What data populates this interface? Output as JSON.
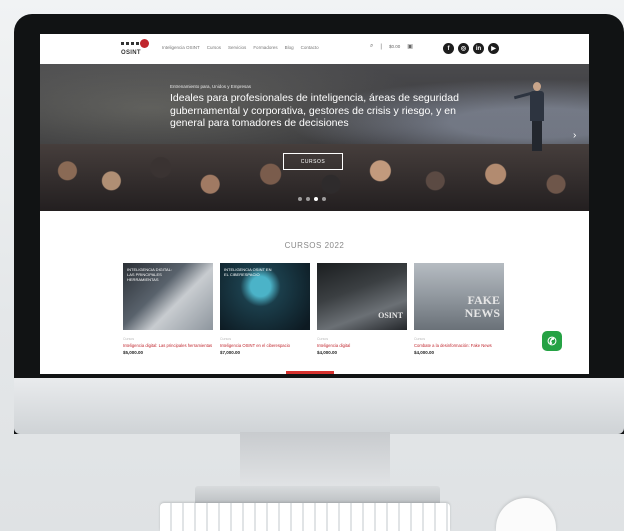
{
  "nav": {
    "logo_text": "OSINT",
    "menu": [
      "Inteligencia OSINT",
      "Cursos",
      "Servicios",
      "Formadores",
      "Blog",
      "Contacto"
    ],
    "cart": "$0.00",
    "social": [
      "f",
      "◎",
      "in",
      "▶"
    ]
  },
  "hero": {
    "kicker": "Entrenamiento para, Unidos y Empresas",
    "title": "Ideales para profesionales de inteligencia, áreas de seguridad gubernamental y corporativa, gestores de crisis y riesgo, y en general para tomadores de decisiones",
    "button": "CURSOS",
    "slide_count": 4,
    "active_slide": 3
  },
  "courses": {
    "title": "CURSOS 2022",
    "items": [
      {
        "category": "Cursos",
        "name": "Inteligencia digital: Las principales herramientas",
        "price": "$5,000.00",
        "overlay": "INTELIGENCIA DIGITAL: LAS PRINCIPALES HERRAMIENTAS"
      },
      {
        "category": "Cursos",
        "name": "Inteligencia OSINT en el ciberespacio",
        "price": "$7,000.00",
        "overlay": "INTELIGENCIA OSINT EN EL CIBERESPACIO"
      },
      {
        "category": "Cursos",
        "name": "Inteligencia digital",
        "price": "$4,000.00",
        "overlay": "",
        "big": "OSINT"
      },
      {
        "category": "Cursos",
        "name": "Combate a la desinformación: Fake News",
        "price": "$4,000.00",
        "overlay": "",
        "big": "FAKE NEWS"
      }
    ]
  },
  "whatsapp": "✆"
}
